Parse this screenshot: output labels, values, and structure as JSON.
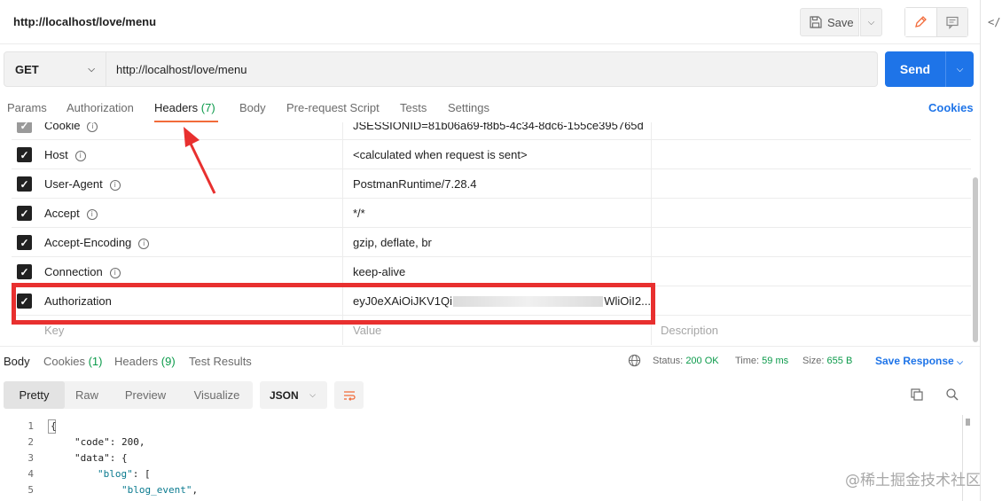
{
  "header": {
    "tab_title": "http://localhost/love/menu",
    "save_label": "Save",
    "icons": [
      "save-icon",
      "caret-down-icon",
      "pencil-icon",
      "comment-icon",
      "code-icon"
    ]
  },
  "request": {
    "method": "GET",
    "url": "http://localhost/love/menu",
    "send_label": "Send"
  },
  "request_tabs": {
    "params": "Params",
    "authorization": "Authorization",
    "headers": "Headers",
    "headers_count": "(7)",
    "body": "Body",
    "pre_request": "Pre-request Script",
    "tests": "Tests",
    "settings": "Settings",
    "cookies": "Cookies"
  },
  "headers_rows": [
    {
      "key": "Cookie",
      "value": "JSESSIONID=81b06a69-f8b5-4c34-8dc6-155ce395765d",
      "checked": true
    },
    {
      "key": "Host",
      "value": "<calculated when request is sent>",
      "checked": true
    },
    {
      "key": "User-Agent",
      "value": "PostmanRuntime/7.28.4",
      "checked": true
    },
    {
      "key": "Accept",
      "value": "*/*",
      "checked": true
    },
    {
      "key": "Accept-Encoding",
      "value": "gzip, deflate, br",
      "checked": true
    },
    {
      "key": "Connection",
      "value": "keep-alive",
      "checked": true
    },
    {
      "key": "Authorization",
      "value_start": "eyJ0eXAiOiJKV1Qi",
      "value_end": "WliOiI2...",
      "checked": true
    }
  ],
  "new_row": {
    "key_placeholder": "Key",
    "value_placeholder": "Value",
    "description_placeholder": "Description"
  },
  "response": {
    "tabs": {
      "body": "Body",
      "cookies": "Cookies",
      "cookies_count": "(1)",
      "headers": "Headers",
      "headers_count": "(9)",
      "test_results": "Test Results"
    },
    "status_label": "Status:",
    "status_value": "200 OK",
    "time_label": "Time:",
    "time_value": "59 ms",
    "size_label": "Size:",
    "size_value": "655 B",
    "save_response": "Save Response",
    "views": {
      "pretty": "Pretty",
      "raw": "Raw",
      "preview": "Preview",
      "visualize": "Visualize"
    },
    "format": "JSON"
  },
  "code_lines": [
    {
      "n": "1",
      "text": "{"
    },
    {
      "n": "2",
      "key": "\"code\"",
      "rest": ": 200,"
    },
    {
      "n": "3",
      "key": "\"data\"",
      "rest": ": {"
    },
    {
      "n": "4",
      "key": "\"blog\"",
      "rest": ": ["
    },
    {
      "n": "5",
      "str": "\"blog_event\"",
      "rest": ","
    }
  ],
  "watermark": "@稀土掘金技术社区",
  "colors": {
    "accent_blue": "#1e74e8",
    "tab_underline": "#f26b3a",
    "count_green": "#0b9a4a",
    "highlight_red": "#e8302f"
  }
}
